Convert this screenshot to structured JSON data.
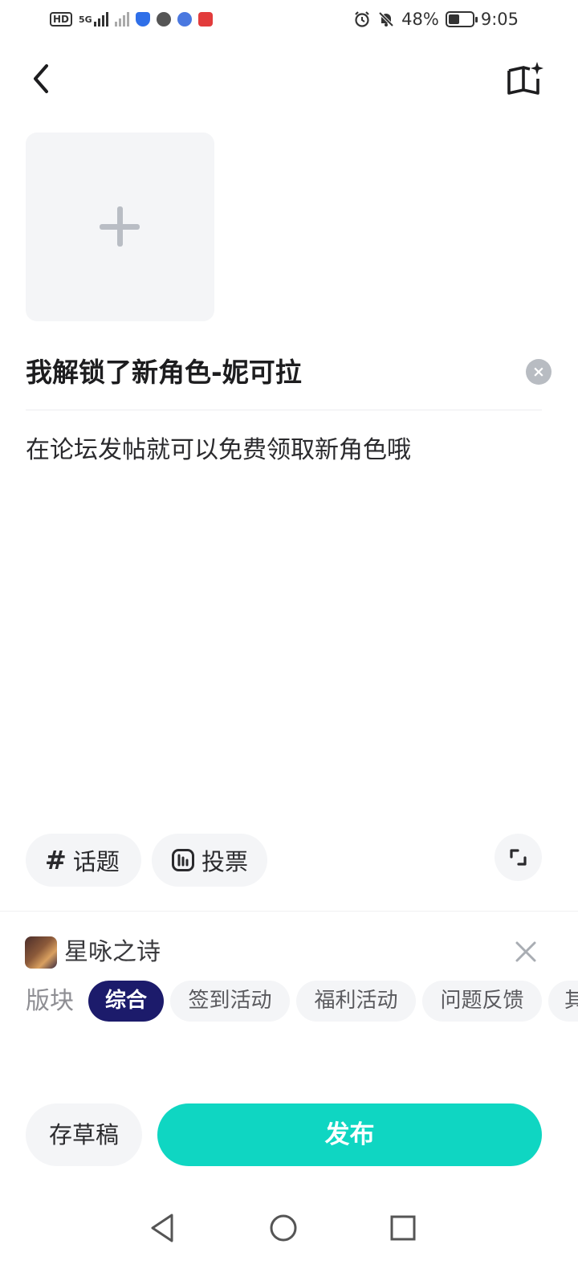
{
  "status_bar": {
    "hd_label": "HD",
    "network": "5G",
    "battery": "48%",
    "battery_level": 0.48,
    "time": "9:05"
  },
  "editor": {
    "title_value": "我解锁了新角色-妮可拉",
    "body_value": "在论坛发帖就可以免费领取新角色哦",
    "clear_symbol": "×"
  },
  "attachments": {
    "topic_label": "话题",
    "topic_symbol": "#",
    "vote_label": "投票"
  },
  "forum": {
    "name": "星咏之诗",
    "section_label": "版块",
    "tags": [
      {
        "label": "综合",
        "active": true
      },
      {
        "label": "签到活动",
        "active": false
      },
      {
        "label": "福利活动",
        "active": false
      },
      {
        "label": "问题反馈",
        "active": false
      },
      {
        "label": "其",
        "active": false
      }
    ]
  },
  "actions": {
    "draft_label": "存草稿",
    "publish_label": "发布"
  },
  "colors": {
    "publish": "#0fd6c2",
    "active_tag": "#1c1b6b",
    "chip_bg": "#f4f5f7"
  }
}
